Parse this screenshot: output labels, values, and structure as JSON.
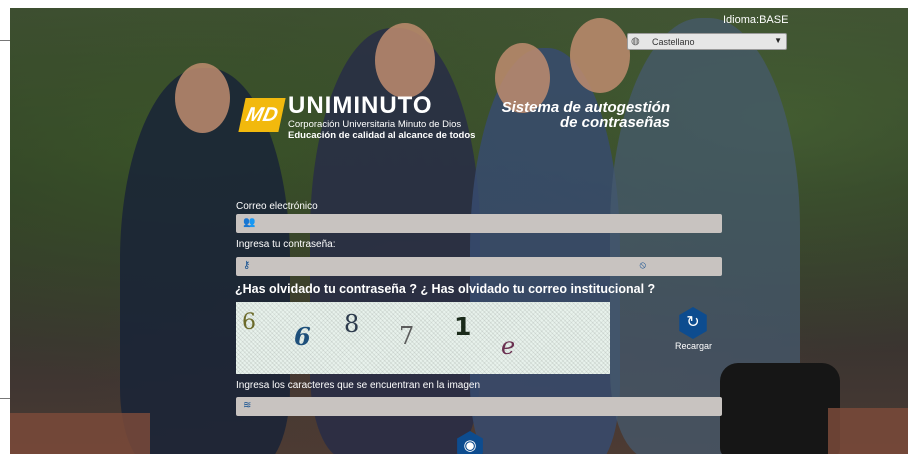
{
  "header": {
    "idioma_label": "Idioma:BASE",
    "language_select": {
      "selected": "Castellano"
    }
  },
  "brand": {
    "logo_mark": "MD",
    "name": "UNIMINUTO",
    "subtitle_1": "Corporación Universitaria Minuto de Dios",
    "subtitle_2": "Educación de calidad al alcance de todos"
  },
  "system_title_1": "Sistema de autogestión",
  "system_title_2": "de contraseñas",
  "form": {
    "email_label": "Correo electrónico",
    "email_value": "",
    "password_label": "Ingresa tu contraseña:",
    "password_value": "",
    "forgot_text": "¿Has olvidado tu contraseña ? ¿ Has olvidado tu correo institucional ?",
    "captcha_chars": [
      "6",
      "6",
      "8",
      "7",
      "1",
      "e"
    ],
    "reload_label": "Recargar",
    "captcha_label": "Ingresa los caracteres que se encuentran en la imagen",
    "captcha_value": ""
  },
  "icons": {
    "globe": "globe-icon",
    "user": "users-icon",
    "key": "key-icon",
    "eye_slash": "eye-slash-icon",
    "captcha_field": "waveform-icon",
    "reload": "reload-icon",
    "submit": "eye-icon"
  },
  "colors": {
    "accent": "#0d4c8f",
    "logo_yellow": "#f2b90d",
    "field_bg": "#c8c3c0"
  }
}
